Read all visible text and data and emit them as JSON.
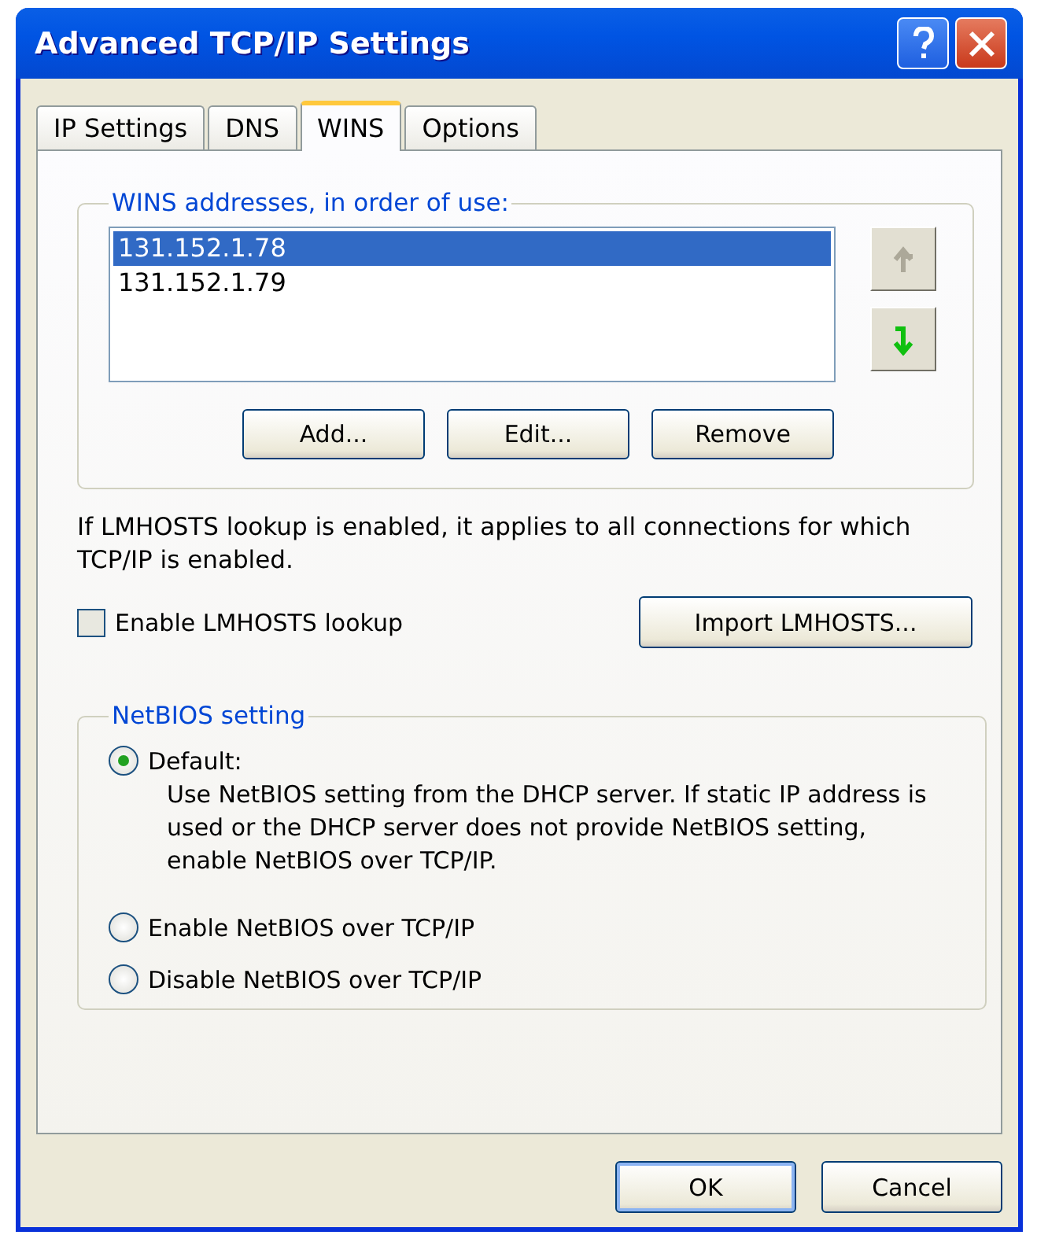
{
  "window": {
    "title": "Advanced TCP/IP Settings"
  },
  "tabs": [
    {
      "label": "IP Settings",
      "selected": false
    },
    {
      "label": "DNS",
      "selected": false
    },
    {
      "label": "WINS",
      "selected": true
    },
    {
      "label": "Options",
      "selected": false
    }
  ],
  "wins_group": {
    "legend": "WINS addresses, in order of use:",
    "addresses": [
      {
        "text": "131.152.1.78",
        "selected": true
      },
      {
        "text": "131.152.1.79",
        "selected": false
      }
    ],
    "move_buttons": [
      {
        "kind": "up",
        "disabled": true
      },
      {
        "kind": "down",
        "disabled": false
      }
    ],
    "buttons": [
      "Add...",
      "Edit...",
      "Remove"
    ]
  },
  "lmhosts": {
    "note": "If LMHOSTS lookup is enabled, it applies to all connections for which TCP/IP is enabled.",
    "checkbox": {
      "label": "Enable LMHOSTS lookup",
      "checked": false
    },
    "import_button": "Import LMHOSTS..."
  },
  "netbios": {
    "legend": "NetBIOS setting",
    "options": [
      {
        "label": "Default:",
        "description": "Use NetBIOS setting from the DHCP server. If static IP address is used or the DHCP server does not provide NetBIOS setting, enable NetBIOS over TCP/IP.",
        "selected": true
      },
      {
        "label": "Enable NetBIOS over TCP/IP",
        "selected": false
      },
      {
        "label": "Disable NetBIOS over TCP/IP",
        "selected": false
      }
    ]
  },
  "buttons": [
    "OK",
    "Cancel"
  ]
}
